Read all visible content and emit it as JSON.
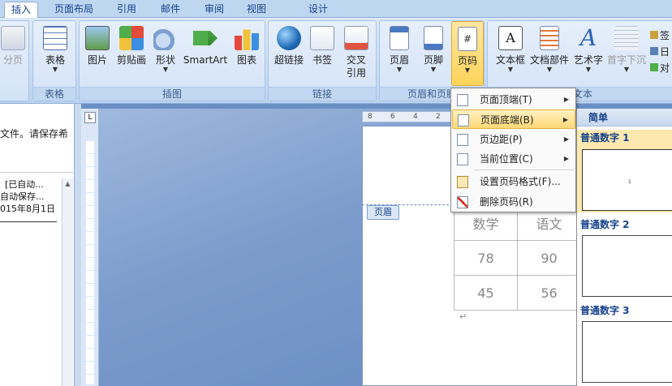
{
  "tabs": [
    {
      "label": "插入",
      "active": true
    },
    {
      "label": "页面布局"
    },
    {
      "label": "引用"
    },
    {
      "label": "邮件"
    },
    {
      "label": "审阅"
    },
    {
      "label": "视图"
    },
    {
      "label": "设计"
    }
  ],
  "ribbon": {
    "partial_left": "分页",
    "groups": {
      "table": {
        "label": "表格",
        "buttons": [
          "表格"
        ]
      },
      "illustrations": {
        "label": "插图",
        "buttons": [
          "图片",
          "剪贴画",
          "形状",
          "SmartArt",
          "图表"
        ]
      },
      "links": {
        "label": "链接",
        "buttons": [
          "超链接",
          "书签",
          "交叉",
          "引用"
        ]
      },
      "header_footer": {
        "label": "页眉和页脚",
        "buttons": [
          "页眉",
          "页脚",
          "页码"
        ]
      },
      "text": {
        "label": "文本",
        "buttons": [
          "文本框",
          "文档部件",
          "艺术字",
          "首字下沉"
        ],
        "side_chars": [
          "签",
          "日",
          "对"
        ]
      }
    }
  },
  "left_pane": {
    "line1": "文件。请保存希",
    "line2": "[已自动...",
    "line3": "自动保存...",
    "line4": "015年8月1日"
  },
  "document": {
    "header_tag": "页眉",
    "ruler": [
      "8",
      "6",
      "4",
      "2"
    ],
    "grades": [
      [
        "数学",
        "语文"
      ],
      [
        "78",
        "90"
      ],
      [
        "45",
        "56"
      ]
    ]
  },
  "menu": {
    "items": [
      {
        "label": "页面顶端(T)",
        "submenu": true
      },
      {
        "label": "页面底端(B)",
        "submenu": true,
        "highlight": true
      },
      {
        "label": "页边距(P)",
        "submenu": true
      },
      {
        "label": "当前位置(C)",
        "submenu": true
      },
      {
        "label": "设置页码格式(F)..."
      },
      {
        "label": "删除页码(R)"
      }
    ]
  },
  "gallery": {
    "section": "简单",
    "items": [
      "普通数字 1",
      "普通数字 2",
      "普通数字 3"
    ],
    "thumb_number": "1"
  }
}
